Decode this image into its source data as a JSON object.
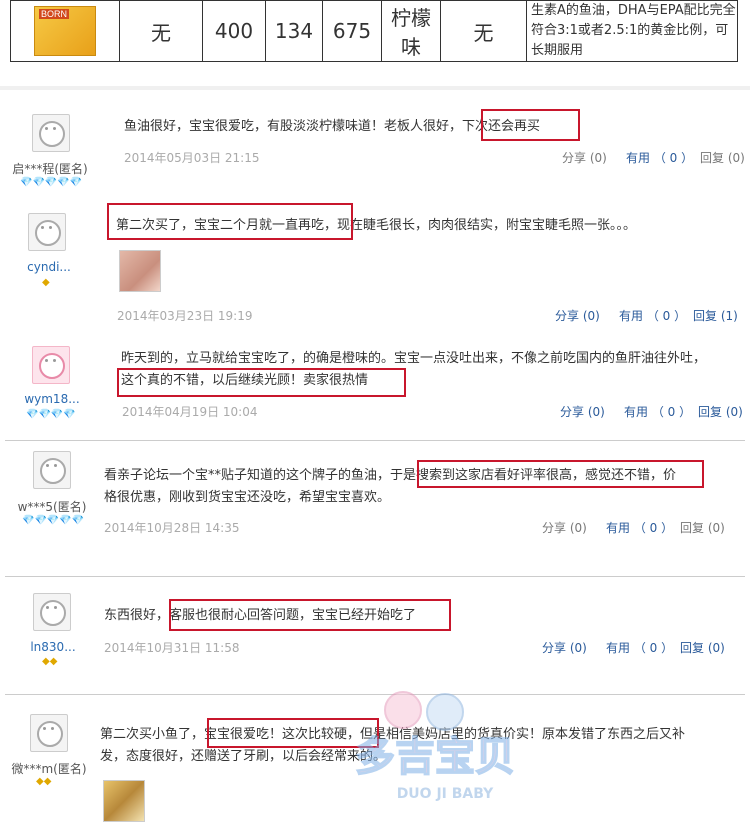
{
  "table": {
    "product_label": "BORN",
    "cells": [
      "无",
      "400",
      "134",
      "675",
      "柠檬味",
      "无"
    ],
    "description": "生素A的鱼油，DHA与EPA配比完全符合3:1或者2.5:1的黄金比例，可长期服用"
  },
  "reviews": [
    {
      "user": "启***程(匿名)",
      "gems": "💎💎💎💎💎",
      "text": "鱼油很好，宝宝很爱吃，有股淡淡柠檬味道！老板人很好，下次还会再买",
      "date": "2014年05月03日 21:15",
      "share": "分享 (0)",
      "useful": "有用 （ 0 ）",
      "reply": "回复 (0)"
    },
    {
      "user": "cyndi...",
      "gems": "◆",
      "text": "第二次买了，宝宝二个月就一直再吃，现在睫毛很长，肉肉很结实，附宝宝睫毛照一张。。。",
      "date": "2014年03月23日 19:19",
      "share": "分享 (0)",
      "useful": "有用 （ 0 ）",
      "reply": "回复 (1)"
    },
    {
      "user": "wym18...",
      "gems": "💎💎💎💎",
      "text1": "昨天到的，立马就给宝宝吃了，的确是橙味的。宝宝一点没吐出来，不像之前吃国内的鱼肝油往外吐，",
      "text2": "这个真的不错，以后继续光顾！卖家很热情",
      "date": "2014年04月19日 10:04",
      "share": "分享 (0)",
      "useful": "有用 （ 0 ）",
      "reply": "回复 (0)"
    },
    {
      "user": "w***5(匿名)",
      "gems": "💎💎💎💎💎",
      "text1": "看亲子论坛一个宝**贴子知道的这个牌子的鱼油，于是搜索到这家店看好评率很高，感觉还不错，价",
      "text2": "格很优惠，刚收到货宝宝还没吃，希望宝宝喜欢。",
      "date": "2014年10月28日 14:35",
      "share": "分享 (0)",
      "useful": "有用 （ 0 ）",
      "reply": "回复 (0)"
    },
    {
      "user": "ln830...",
      "gems": "◆◆",
      "text": "东西很好，客服也很耐心回答问题，宝宝已经开始吃了",
      "date": "2014年10月31日 11:58",
      "share": "分享 (0)",
      "useful": "有用 （ 0 ）",
      "reply": "回复 (0)"
    },
    {
      "user": "微***m(匿名)",
      "gems": "◆◆",
      "text1": "第二次买小鱼了，宝宝很爱吃！这次比较硬，但是相信美妈店里的货真价实！原本发错了东西之后又补",
      "text2": "发，态度很好，还赠送了牙刷，以后会经常来的。"
    }
  ],
  "watermark": {
    "text": "多吉宝贝",
    "subtext": "DUO JI BABY"
  },
  "colors": {
    "highlight": "#c8162c",
    "link": "#2a5a9a",
    "gem_red": "#d0102a",
    "gem_gold": "#e0a800"
  }
}
